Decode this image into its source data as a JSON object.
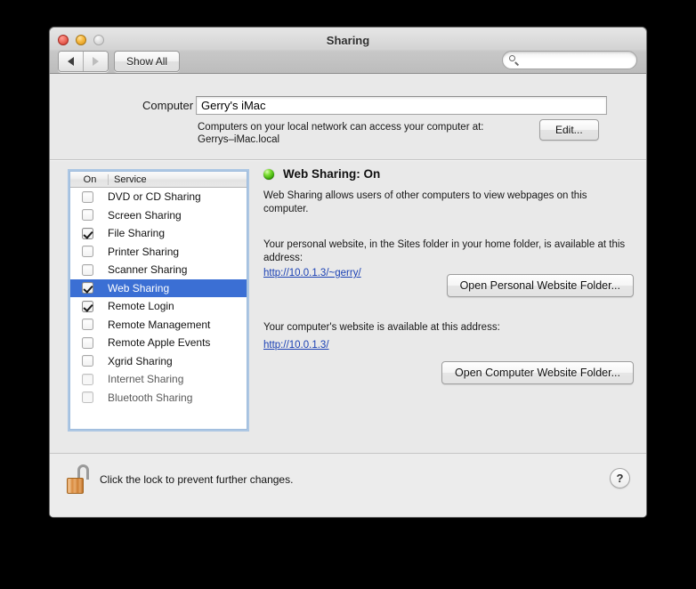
{
  "window": {
    "title": "Sharing",
    "traffic_lights": [
      "close",
      "minimize",
      "zoom"
    ]
  },
  "toolbar": {
    "back_label": "◀",
    "forward_label": "▶",
    "show_all_label": "Show All",
    "search_value": "",
    "search_placeholder": ""
  },
  "computer_name": {
    "label": "Computer Name:",
    "value": "Gerry's iMac",
    "description_line1": "Computers on your local network can access your computer at:",
    "description_line2": "Gerrys–iMac.local",
    "edit_label": "Edit..."
  },
  "service_list": {
    "header_on": "On",
    "header_service": "Service",
    "rows": [
      {
        "label": "DVD or CD Sharing",
        "checked": false,
        "selected": false,
        "dimmed": false
      },
      {
        "label": "Screen Sharing",
        "checked": false,
        "selected": false,
        "dimmed": false
      },
      {
        "label": "File Sharing",
        "checked": true,
        "selected": false,
        "dimmed": false
      },
      {
        "label": "Printer Sharing",
        "checked": false,
        "selected": false,
        "dimmed": false
      },
      {
        "label": "Scanner Sharing",
        "checked": false,
        "selected": false,
        "dimmed": false
      },
      {
        "label": "Web Sharing",
        "checked": true,
        "selected": true,
        "dimmed": false
      },
      {
        "label": "Remote Login",
        "checked": true,
        "selected": false,
        "dimmed": false
      },
      {
        "label": "Remote Management",
        "checked": false,
        "selected": false,
        "dimmed": false
      },
      {
        "label": "Remote Apple Events",
        "checked": false,
        "selected": false,
        "dimmed": false
      },
      {
        "label": "Xgrid Sharing",
        "checked": false,
        "selected": false,
        "dimmed": false
      },
      {
        "label": "Internet Sharing",
        "checked": false,
        "selected": false,
        "dimmed": true
      },
      {
        "label": "Bluetooth Sharing",
        "checked": false,
        "selected": false,
        "dimmed": true
      }
    ]
  },
  "detail": {
    "status_text": "Web Sharing: On",
    "status_color": "#4fbe12",
    "description": "Web Sharing allows users of other computers to view webpages on this computer.",
    "personal_text": "Your personal website, in the Sites folder in your home folder, is available at this address:",
    "personal_link": "http://10.0.1.3/~gerry/",
    "personal_button": "Open Personal Website Folder...",
    "computer_text": "Your computer's website is available at this address:",
    "computer_link": "http://10.0.1.3/",
    "computer_button": "Open Computer Website Folder..."
  },
  "lockbar": {
    "lock_state": "unlocked",
    "text": "Click the lock to prevent further changes.",
    "help_label": "?"
  }
}
